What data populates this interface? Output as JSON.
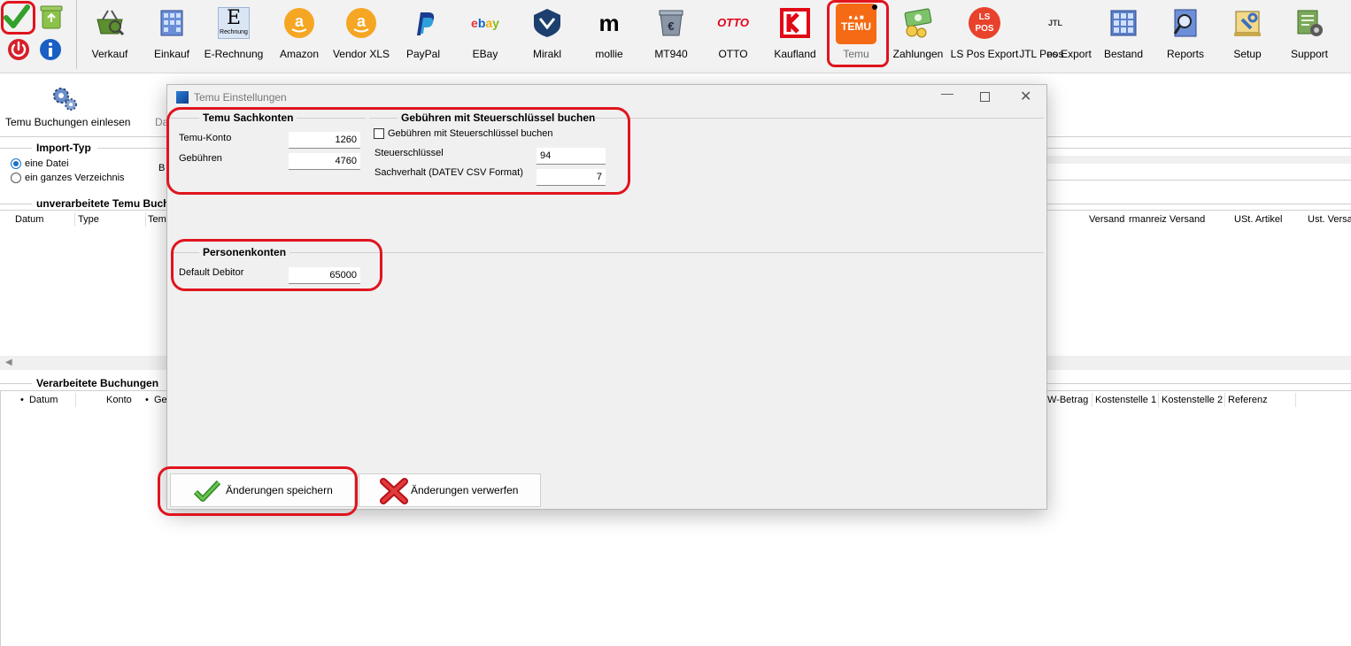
{
  "toolbar": {
    "items": [
      {
        "label": "Verkauf",
        "icon": "basket-icon"
      },
      {
        "label": "Einkauf",
        "icon": "building-icon"
      },
      {
        "label": "E-Rechnung",
        "icon": "e-rechnung-icon",
        "icon_text": "E",
        "icon_sub": "Rechnung"
      },
      {
        "label": "Amazon",
        "icon": "amazon-icon"
      },
      {
        "label": "Vendor XLS",
        "icon": "amazon-icon"
      },
      {
        "label": "PayPal",
        "icon": "paypal-icon"
      },
      {
        "label": "EBay",
        "icon": "ebay-icon",
        "icon_text": "ebay"
      },
      {
        "label": "Mirakl",
        "icon": "mirakl-icon"
      },
      {
        "label": "mollie",
        "icon": "mollie-icon",
        "icon_text": "m"
      },
      {
        "label": "MT940",
        "icon": "mt940-icon"
      },
      {
        "label": "OTTO",
        "icon": "otto-icon",
        "icon_text": "OTTO"
      },
      {
        "label": "Kaufland",
        "icon": "kaufland-icon"
      },
      {
        "label": "Temu",
        "icon": "temu-icon",
        "icon_text": "TEMU"
      },
      {
        "label": "Zahlungen",
        "icon": "money-icon"
      },
      {
        "label": "LS Pos Export",
        "icon": "ls-pos-icon",
        "icon_text": "LS POS"
      },
      {
        "label": "JTL Pos Export",
        "icon": "jtl-pos-icon",
        "icon_text": "JTL POS"
      },
      {
        "label": "Bestand",
        "icon": "building-icon"
      },
      {
        "label": "Reports",
        "icon": "reports-icon"
      },
      {
        "label": "Setup",
        "icon": "setup-icon"
      },
      {
        "label": "Support",
        "icon": "support-icon"
      }
    ]
  },
  "subtoolbar": {
    "import_label": "Temu Buchungen einlesen",
    "cut_label": "Da"
  },
  "import_type": {
    "title": "Import-Typ",
    "options": [
      "eine Datei",
      "ein ganzes Verzeichnis"
    ],
    "cut_label": "B"
  },
  "unprocessed": {
    "title": "unverarbeitete Temu Buch",
    "columns_left": [
      "Datum",
      "Type",
      "Temu"
    ],
    "columns_right": [
      "Versand",
      "rmanreiz Versand",
      "USt. Artikel",
      "Ust. Versa"
    ]
  },
  "processed": {
    "title": "Verarbeitete Buchungen",
    "columns_left": [
      "Datum",
      "Konto",
      "Ge"
    ],
    "columns_right": [
      "W-Betrag",
      "Kostenstelle 1",
      "Kostenstelle 2",
      "Referenz"
    ]
  },
  "dialog": {
    "title": "Temu Einstellungen",
    "sachkonten": {
      "title": "Temu Sachkonten",
      "temu_konto_label": "Temu-Konto",
      "temu_konto_value": "1260",
      "gebuehren_label": "Gebühren",
      "gebuehren_value": "4760"
    },
    "steuer": {
      "title": "Gebühren mit Steuerschlüssel buchen",
      "checkbox_label": "Gebühren mit Steuerschlüssel buchen",
      "checkbox_checked": false,
      "steuerschluessel_label": "Steuerschlüssel",
      "steuerschluessel_value": "94",
      "sachverhalt_label": "Sachverhalt (DATEV CSV Format)",
      "sachverhalt_value": "7"
    },
    "personen": {
      "title": "Personenkonten",
      "debitor_label": "Default Debitor",
      "debitor_value": "65000"
    },
    "save_label": "Änderungen speichern",
    "discard_label": "Änderungen verwerfen"
  },
  "colors": {
    "highlight": "#e0141e",
    "temu": "#f56a14",
    "accent": "#1a73c7"
  }
}
